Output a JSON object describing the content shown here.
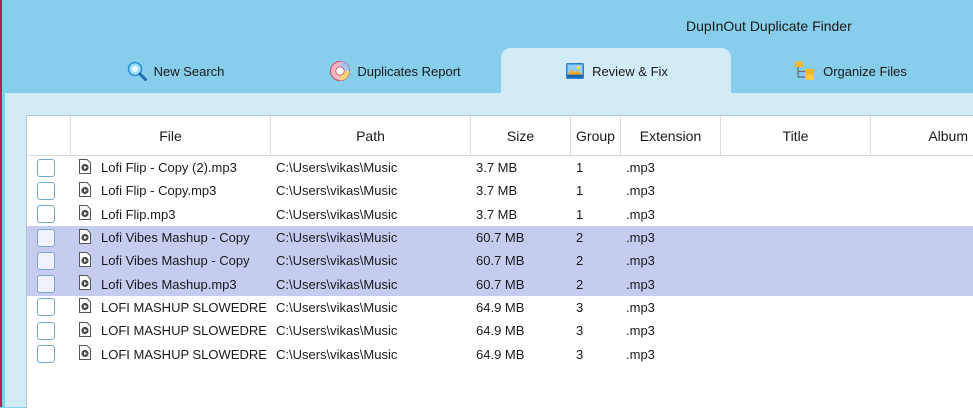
{
  "app": {
    "title": "DupInOut Duplicate Finder"
  },
  "tabs": [
    {
      "label": "New Search",
      "icon": "search-icon"
    },
    {
      "label": "Duplicates Report",
      "icon": "report-icon"
    },
    {
      "label": "Review & Fix",
      "icon": "image-icon",
      "active": true
    },
    {
      "label": "Organize Files",
      "icon": "folder-tree-icon"
    }
  ],
  "table": {
    "columns": [
      "",
      "File",
      "Path",
      "Size",
      "Group",
      "Extension",
      "Title",
      "Album"
    ],
    "rows": [
      {
        "file": "Lofi Flip - Copy (2).mp3",
        "path": "C:\\Users\\vikas\\Music",
        "size": "3.7 MB",
        "group": "1",
        "ext": ".mp3",
        "title": "",
        "album": "",
        "selected": false
      },
      {
        "file": "Lofi Flip - Copy.mp3",
        "path": "C:\\Users\\vikas\\Music",
        "size": "3.7 MB",
        "group": "1",
        "ext": ".mp3",
        "title": "",
        "album": "",
        "selected": false
      },
      {
        "file": "Lofi Flip.mp3",
        "path": "C:\\Users\\vikas\\Music",
        "size": "3.7 MB",
        "group": "1",
        "ext": ".mp3",
        "title": "",
        "album": "",
        "selected": false
      },
      {
        "file": "Lofi Vibes Mashup - Copy",
        "path": "C:\\Users\\vikas\\Music",
        "size": "60.7 MB",
        "group": "2",
        "ext": ".mp3",
        "title": "",
        "album": "",
        "selected": true
      },
      {
        "file": "Lofi Vibes Mashup - Copy",
        "path": "C:\\Users\\vikas\\Music",
        "size": "60.7 MB",
        "group": "2",
        "ext": ".mp3",
        "title": "",
        "album": "",
        "selected": true
      },
      {
        "file": "Lofi Vibes Mashup.mp3",
        "path": "C:\\Users\\vikas\\Music",
        "size": "60.7 MB",
        "group": "2",
        "ext": ".mp3",
        "title": "",
        "album": "",
        "selected": true
      },
      {
        "file": "LOFI MASHUP SLOWEDRE",
        "path": "C:\\Users\\vikas\\Music",
        "size": "64.9 MB",
        "group": "3",
        "ext": ".mp3",
        "title": "",
        "album": "",
        "selected": false
      },
      {
        "file": "LOFI MASHUP SLOWEDRE",
        "path": "C:\\Users\\vikas\\Music",
        "size": "64.9 MB",
        "group": "3",
        "ext": ".mp3",
        "title": "",
        "album": "",
        "selected": false
      },
      {
        "file": "LOFI MASHUP SLOWEDRE",
        "path": "C:\\Users\\vikas\\Music",
        "size": "64.9 MB",
        "group": "3",
        "ext": ".mp3",
        "title": "",
        "album": "",
        "selected": false
      }
    ]
  },
  "colors": {
    "header_bg": "#87CEEB",
    "panel_bg": "#D1ECF6",
    "selected_row": "#C5CCF0"
  }
}
